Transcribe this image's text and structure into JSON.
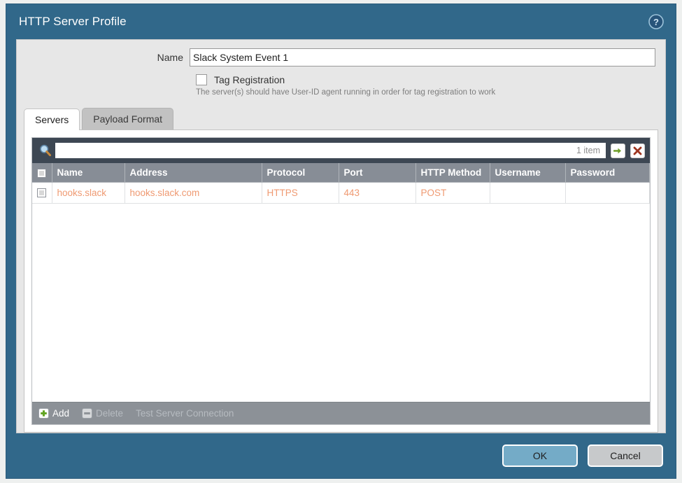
{
  "dialog": {
    "title": "HTTP Server Profile",
    "help_icon": "help-circle-icon"
  },
  "form": {
    "name_label": "Name",
    "name_value": "Slack System Event 1",
    "name_placeholder": "",
    "tag_registration_label": "Tag Registration",
    "tag_registration_checked": false,
    "tag_registration_hint": "The server(s) should have User-ID agent running in order for tag registration to work"
  },
  "tabs": [
    {
      "label": "Servers",
      "active": true
    },
    {
      "label": "Payload Format",
      "active": false
    }
  ],
  "grid": {
    "search_placeholder": "",
    "search_value": "",
    "item_count": "1 item",
    "apply_filter_icon": "arrow-right-icon",
    "clear_filter_icon": "close-x-icon",
    "search_icon": "magnifier-icon",
    "columns": [
      "Name",
      "Address",
      "Protocol",
      "Port",
      "HTTP Method",
      "Username",
      "Password"
    ],
    "rows": [
      {
        "selected": false,
        "Name": "hooks.slack",
        "Address": "hooks.slack.com",
        "Protocol": "HTTPS",
        "Port": "443",
        "HTTP Method": "POST",
        "Username": "",
        "Password": ""
      }
    ]
  },
  "grid_toolbar": [
    {
      "label": "Add",
      "icon": "plus-icon",
      "enabled": true
    },
    {
      "label": "Delete",
      "icon": "minus-icon",
      "enabled": false
    },
    {
      "label": "Test Server Connection",
      "icon": "",
      "enabled": false
    }
  ],
  "footer": {
    "ok_label": "OK",
    "cancel_label": "Cancel"
  },
  "colors": {
    "dialog_frame": "#31688a",
    "panel_bg": "#e7e7e7",
    "search_bar": "#3d4753",
    "table_header": "#878d96",
    "table_cell_text": "#ef9a72",
    "grid_toolbar": "#8c9197",
    "ok_button": "#74abc7",
    "cancel_button": "#c7c9cb"
  }
}
